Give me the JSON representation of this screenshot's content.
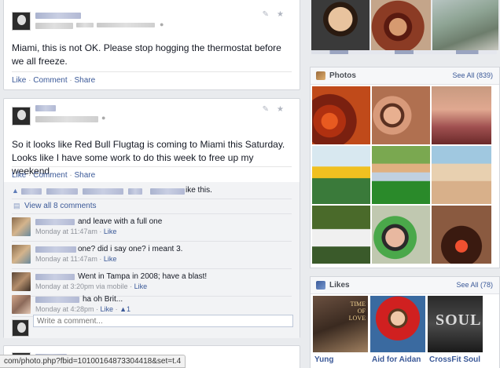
{
  "post1": {
    "text": "Miami, this is not OK. Please stop hogging the thermostat before we all freeze.",
    "actions": [
      "Like",
      "Comment",
      "Share"
    ]
  },
  "post2": {
    "text": "So it looks like Red Bull Flugtag is coming to Miami this Saturday. Looks like I have some work to do this week to free up my weekend.",
    "actions": [
      "Like",
      "Comment",
      "Share"
    ],
    "like_summary_tail": "ike this.",
    "view_comments": "View all 8 comments",
    "comments": [
      {
        "text": "and leave with a full one",
        "time": "Monday at 11:47am",
        "action": "Like"
      },
      {
        "text": "one? did i say one? i meant 3.",
        "time": "Monday at 11:47am",
        "action": "Like"
      },
      {
        "text": "Went in Tampa in 2008; have a blast!",
        "time": "Monday at 3:20pm via mobile",
        "action": "Like"
      },
      {
        "text": "ha oh Brit...",
        "time": "Monday at 4:28pm",
        "action": "Like",
        "likes": "1"
      }
    ],
    "comment_placeholder": "Write a comment..."
  },
  "photos": {
    "title": "Photos",
    "see_all": "See All (839)"
  },
  "likes": {
    "title": "Likes",
    "see_all": "See All (78)",
    "items": [
      {
        "name": "Yung",
        "tile_text": "TIME OF LOVE"
      },
      {
        "name": "Aid for Aidan"
      },
      {
        "name": "CrossFit Soul",
        "tile_text": "SOUL"
      }
    ]
  },
  "status_bar": {
    "url": "com/photo.php?fbid=10100164873304418&set=t.4"
  },
  "colors": {
    "link": "#3b5998",
    "page_bg": "#e9ebee"
  }
}
